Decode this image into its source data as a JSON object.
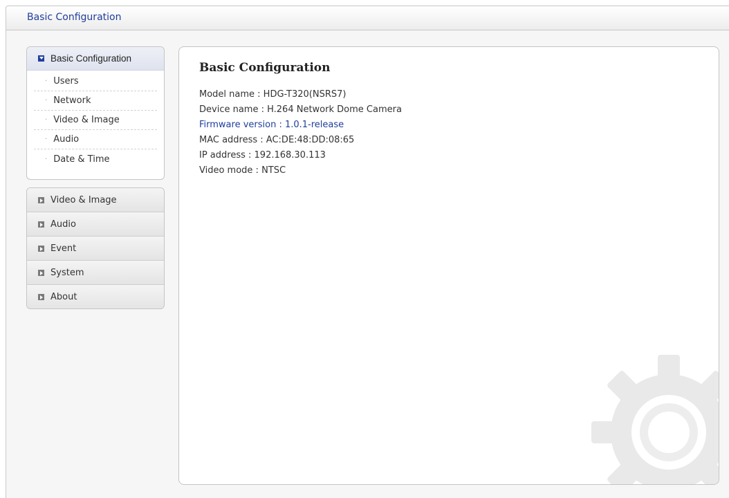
{
  "header": {
    "title": "Basic Configuration"
  },
  "sidebar": {
    "expanded": {
      "label": "Basic Configuration",
      "items": [
        {
          "label": "Users"
        },
        {
          "label": "Network"
        },
        {
          "label": "Video & Image"
        },
        {
          "label": "Audio"
        },
        {
          "label": "Date & Time"
        }
      ]
    },
    "collapsed": [
      {
        "label": "Video & Image"
      },
      {
        "label": "Audio"
      },
      {
        "label": "Event"
      },
      {
        "label": "System"
      },
      {
        "label": "About"
      }
    ]
  },
  "main": {
    "title": "Basic Configuration",
    "info": {
      "model": "Model name : HDG-T320(NSRS7)",
      "device": "Device name : H.264 Network Dome Camera",
      "firmware": "Firmware version : 1.0.1-release",
      "mac": "MAC address : AC:DE:48:DD:08:65",
      "ip": "IP address : 192.168.30.113",
      "video_mode": "Video mode : NTSC"
    }
  },
  "colors": {
    "accent": "#1f3e9c",
    "panel_border": "#c4c4c4",
    "background": "#f6f6f6"
  },
  "icons": {
    "expanded_marker": "expand-arrow-icon",
    "collapsed_marker": "collapse-arrow-icon",
    "watermark": "gear-icon"
  }
}
